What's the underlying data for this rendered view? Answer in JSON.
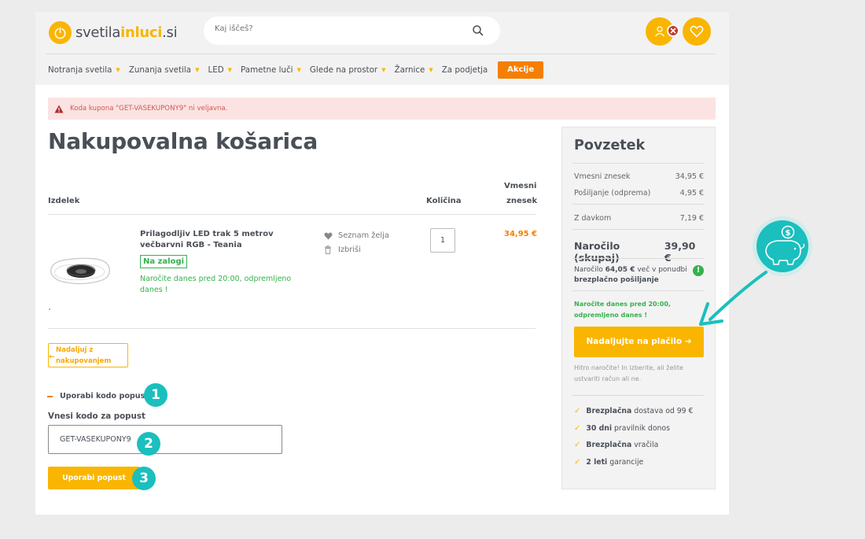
{
  "header": {
    "logo_part1": "svetila",
    "logo_part2": "inluci",
    "logo_part3": ".si",
    "search_placeholder": "Kaj iščeš?"
  },
  "nav": {
    "items": [
      "Notranja svetila",
      "Zunanja svetila",
      "LED",
      "Pametne luči",
      "Glede na prostor",
      "Žarnice",
      "Za podjetja"
    ],
    "akcije": "Akcije"
  },
  "alert": {
    "text": "Koda kupona \"GET-VASEKUPONY9\" ni veljavna."
  },
  "cart": {
    "title": "Nakupovalna košarica",
    "col_product": "Izdelek",
    "col_quantity": "Količina",
    "col_subtotal_1": "Vmesni",
    "col_subtotal_2": "znesek",
    "product_name": "Prilagodljiv LED trak 5 metrov večbarvni RGB - Teania",
    "stock": "Na zalogi",
    "delivery": "Naročite danes pred 20:00, odpremljeno danes !",
    "wishlist": "Seznam želja",
    "delete": "Izbriši",
    "quantity": "1",
    "price": "34,95 €",
    "continue_shopping": "Nadaljuj z nakupovanjem",
    "coupon_toggle": "Uporabi kodo popusta",
    "coupon_label": "Vnesi kodo za popust",
    "coupon_value": "GET-VASEKUPONY9",
    "coupon_button": "Uporabi popust"
  },
  "badges": [
    "1",
    "2",
    "3"
  ],
  "summary": {
    "title": "Povzetek",
    "subtotal_label": "Vmesni znesek",
    "subtotal_value": "34,95 €",
    "shipping_label": "Pošiljanje (odprema)",
    "shipping_value": "4,95 €",
    "tax_label": "Z davkom",
    "tax_value": "7,19 €",
    "total_label": "Naročilo (skupaj)",
    "total_value": "39,90 €",
    "free_prefix": "Naročilo",
    "free_amount": "64,05 €",
    "free_middle": "več v ponudbi",
    "free_suffix": "brezplačno pošiljanje",
    "order_today": "Naročite danes pred 20:00, odpremljeno danes !",
    "pay_button": "Nadaljujte na plačilo",
    "quick_note": "Hitro naročite! In izberite, ali želite ustvariti račun ali ne.",
    "perks": [
      {
        "bold": "Brezplačna",
        "text": "dostava od 99 €"
      },
      {
        "bold": "30 dni",
        "text": "pravilnik donos"
      },
      {
        "bold": "Brezplačna",
        "text": "vračila"
      },
      {
        "bold": "2 leti",
        "text": "garancije"
      }
    ]
  },
  "colors": {
    "brand": "#f9b500",
    "accent_orange": "#f57f00",
    "success": "#35b14e",
    "alert_bg": "#fbe3e3",
    "alert_text": "#d1584f",
    "annotation_teal": "#1bbfbd"
  }
}
